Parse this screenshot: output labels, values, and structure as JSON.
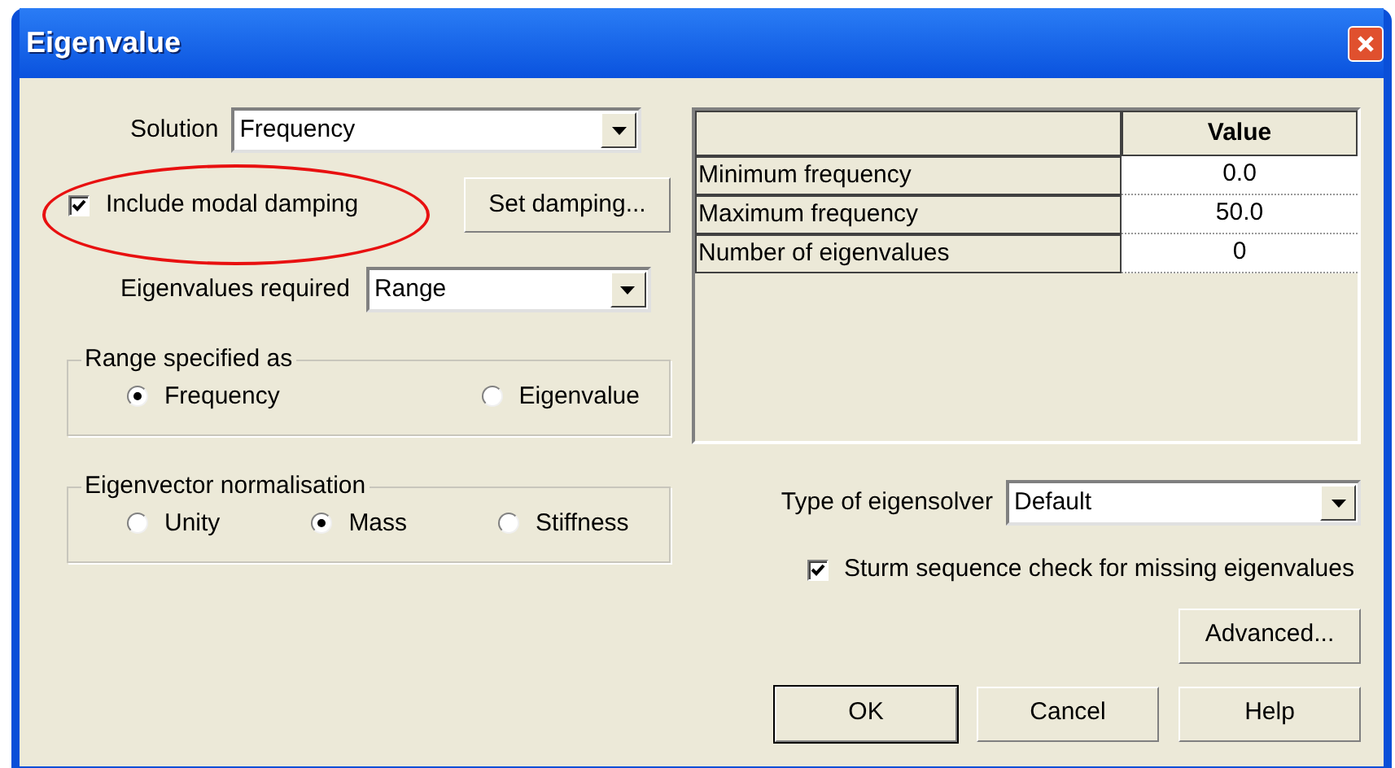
{
  "window": {
    "title": "Eigenvalue"
  },
  "solution": {
    "label": "Solution",
    "value": "Frequency"
  },
  "modal_damping": {
    "label": "Include modal damping",
    "checked": true,
    "highlighted": true
  },
  "set_damping_button": "Set damping...",
  "eigenvalues_required": {
    "label": "Eigenvalues required",
    "value": "Range"
  },
  "range_group": {
    "title": "Range specified as",
    "options": [
      {
        "label": "Frequency",
        "selected": true
      },
      {
        "label": "Eigenvalue",
        "selected": false
      }
    ]
  },
  "normalisation_group": {
    "title": "Eigenvector normalisation",
    "options": [
      {
        "label": "Unity",
        "selected": false
      },
      {
        "label": "Mass",
        "selected": true
      },
      {
        "label": "Stiffness",
        "selected": false
      }
    ]
  },
  "table": {
    "columns": [
      "Value"
    ],
    "rows": [
      {
        "name": "Minimum frequency",
        "value": "0.0"
      },
      {
        "name": "Maximum frequency",
        "value": "50.0"
      },
      {
        "name": "Number of eigenvalues",
        "value": "0"
      }
    ]
  },
  "eigensolver": {
    "label": "Type of eigensolver",
    "value": "Default"
  },
  "sturm_check": {
    "label": "Sturm sequence check for missing eigenvalues",
    "checked": true
  },
  "advanced_button": "Advanced...",
  "buttons": [
    {
      "label": "OK",
      "default": true
    },
    {
      "label": "Cancel",
      "default": false
    },
    {
      "label": "Help",
      "default": false
    }
  ]
}
